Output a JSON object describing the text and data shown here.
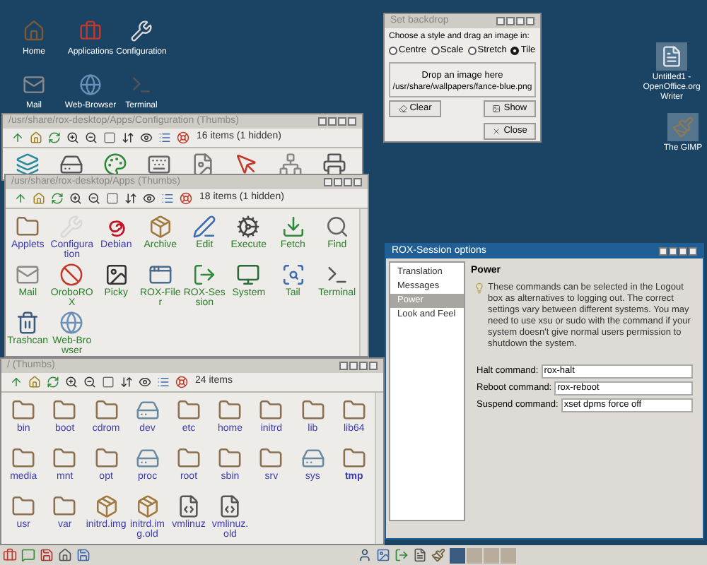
{
  "desktop_icons": [
    {
      "label": "Home",
      "kind": "home"
    },
    {
      "label": "Applications",
      "kind": "toolbox"
    },
    {
      "label": "Configuration",
      "kind": "tools"
    },
    {
      "label": "Mail",
      "kind": "mail"
    },
    {
      "label": "Web-Browser",
      "kind": "globe"
    },
    {
      "label": "Terminal",
      "kind": "terminal"
    },
    {
      "label": "Untitled1 - OpenOffice.org Writer",
      "kind": "document"
    },
    {
      "label": "The GIMP",
      "kind": "paint"
    }
  ],
  "config_window": {
    "title": "/usr/share/rox-desktop/Apps/Configuration (Thumbs)",
    "status": "16 items (1 hidden)"
  },
  "apps_window": {
    "title": "/usr/share/rox-desktop/Apps (Thumbs)",
    "status": "18 items (1 hidden)",
    "items": [
      {
        "label": "Applets",
        "kind": "folder",
        "application": false
      },
      {
        "label": "Configuration",
        "kind": "tools",
        "application": false
      },
      {
        "label": "Debian",
        "kind": "swirl",
        "application": false
      },
      {
        "label": "Archive",
        "kind": "package",
        "application": true
      },
      {
        "label": "Edit",
        "kind": "pen",
        "application": true
      },
      {
        "label": "Execute",
        "kind": "gear",
        "application": true
      },
      {
        "label": "Fetch",
        "kind": "download",
        "application": true
      },
      {
        "label": "Find",
        "kind": "search",
        "application": true
      },
      {
        "label": "Mail",
        "kind": "mail",
        "application": true
      },
      {
        "label": "OroboROX",
        "kind": "blocked",
        "application": true
      },
      {
        "label": "Picky",
        "kind": "image",
        "application": true
      },
      {
        "label": "ROX-Filer",
        "kind": "window",
        "application": true
      },
      {
        "label": "ROX-Session",
        "kind": "exit",
        "application": true
      },
      {
        "label": "System",
        "kind": "monitor",
        "application": true
      },
      {
        "label": "Tail",
        "kind": "magnifier",
        "application": true
      },
      {
        "label": "Terminal",
        "kind": "terminal",
        "application": true
      },
      {
        "label": "Trashcan",
        "kind": "trash",
        "application": true
      },
      {
        "label": "Web-Browser",
        "kind": "globe",
        "application": true
      }
    ]
  },
  "root_window": {
    "title": "/ (Thumbs)",
    "status": "24 items",
    "items": [
      {
        "label": "bin",
        "kind": "folder",
        "bold": false
      },
      {
        "label": "boot",
        "kind": "folder",
        "bold": false
      },
      {
        "label": "cdrom",
        "kind": "folder",
        "bold": false
      },
      {
        "label": "dev",
        "kind": "device",
        "bold": false
      },
      {
        "label": "etc",
        "kind": "folder",
        "bold": false
      },
      {
        "label": "home",
        "kind": "folder",
        "bold": false
      },
      {
        "label": "initrd",
        "kind": "folder",
        "bold": false
      },
      {
        "label": "lib",
        "kind": "folder",
        "bold": false
      },
      {
        "label": "lib64",
        "kind": "folder",
        "bold": false
      },
      {
        "label": "media",
        "kind": "folder",
        "bold": false
      },
      {
        "label": "mnt",
        "kind": "folder",
        "bold": false
      },
      {
        "label": "opt",
        "kind": "folder",
        "bold": false
      },
      {
        "label": "proc",
        "kind": "device",
        "bold": false
      },
      {
        "label": "root",
        "kind": "folder",
        "bold": false
      },
      {
        "label": "sbin",
        "kind": "folder",
        "bold": false
      },
      {
        "label": "srv",
        "kind": "folder",
        "bold": false
      },
      {
        "label": "sys",
        "kind": "device",
        "bold": false
      },
      {
        "label": "tmp",
        "kind": "folder",
        "bold": true
      },
      {
        "label": "usr",
        "kind": "folder",
        "bold": false
      },
      {
        "label": "var",
        "kind": "folder",
        "bold": false
      },
      {
        "label": "initrd.img",
        "kind": "package",
        "bold": false
      },
      {
        "label": "initrd.img.old",
        "kind": "package",
        "bold": false
      },
      {
        "label": "vmlinuz",
        "kind": "binary",
        "bold": false
      },
      {
        "label": "vmlinuz.old",
        "kind": "binary",
        "bold": false
      }
    ]
  },
  "backdrop_dialog": {
    "title": "Set backdrop",
    "prompt": "Choose a style and drag an image in:",
    "styles": [
      {
        "label": "Centre",
        "selected": false
      },
      {
        "label": "Scale",
        "selected": false
      },
      {
        "label": "Stretch",
        "selected": false
      },
      {
        "label": "Tile",
        "selected": true
      }
    ],
    "drop_hint": "Drop an image here",
    "path": "/usr/share/wallpapers/fance-blue.png",
    "buttons": [
      {
        "label": "Clear",
        "kind": "clear"
      },
      {
        "label": "Show",
        "kind": "show"
      },
      {
        "label": "Close",
        "kind": "close"
      }
    ]
  },
  "session_options": {
    "title": "ROX-Session options",
    "sections": [
      {
        "label": "Translation",
        "selected": false
      },
      {
        "label": "Messages",
        "selected": false
      },
      {
        "label": "Power",
        "selected": true
      },
      {
        "label": "Look and Feel",
        "selected": false
      }
    ],
    "heading": "Power",
    "description": "These commands can be selected in the Logout box as alternatives to logging out. The correct settings vary between different systems. You may need to use xsu or sudo with the command if your system doesn't give normal users permission to shutdown the system.",
    "fields": [
      {
        "label": "Halt command:",
        "value": "rox-halt"
      },
      {
        "label": "Reboot command:",
        "value": "rox-reboot"
      },
      {
        "label": "Suspend command:",
        "value": "xset dpms force off"
      }
    ]
  }
}
